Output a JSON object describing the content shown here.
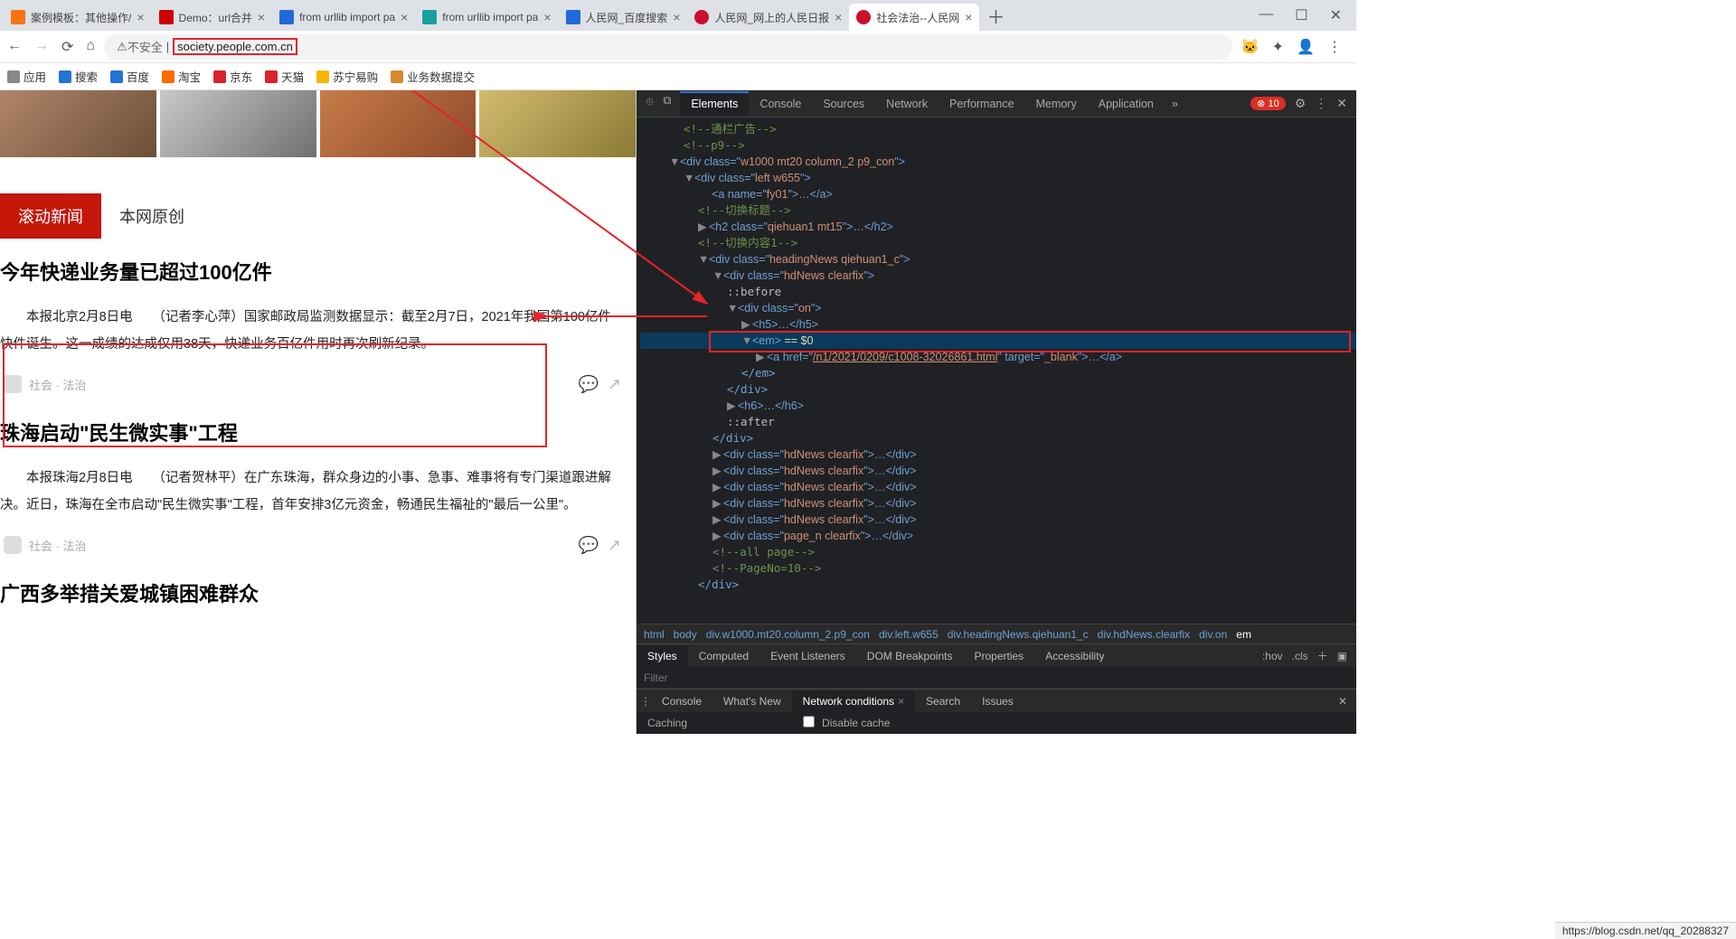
{
  "tabs": [
    {
      "title": "案例模板：其他操作/",
      "favicon": "orange"
    },
    {
      "title": "Demo：url合并",
      "favicon": "red"
    },
    {
      "title": "from urllib import pa",
      "favicon": "blue"
    },
    {
      "title": "from urllib import pa",
      "favicon": "teal"
    },
    {
      "title": "人民网_百度搜索",
      "favicon": "blue"
    },
    {
      "title": "人民网_网上的人民日报",
      "favicon": "redcircle"
    },
    {
      "title": "社会法治--人民网",
      "favicon": "redcircle",
      "active": true
    }
  ],
  "url": {
    "insecure": "不安全",
    "highlighted": "society.people.com.cn"
  },
  "bookmarks": [
    {
      "label": "应用",
      "icon": "#555"
    },
    {
      "label": "搜索",
      "icon": "#2473d5"
    },
    {
      "label": "百度",
      "icon": "#2473d5"
    },
    {
      "label": "淘宝",
      "icon": "#ff6a00"
    },
    {
      "label": "京东",
      "icon": "#d9232e"
    },
    {
      "label": "天猫",
      "icon": "#d9232e"
    },
    {
      "label": "苏宁易购",
      "icon": "#f7b500"
    },
    {
      "label": "业务数据提交",
      "icon": "#d98a2e"
    }
  ],
  "page": {
    "tab_active": "滚动新闻",
    "tab_other": "本网原创",
    "article1_title": "今年快递业务量已超过100亿件",
    "article1_body": "　　本报北京2月8日电　　（记者李心萍）国家邮政局监测数据显示：截至2月7日，2021年我国第100亿件快件诞生。这一成绩的达成仅用38天，快递业务百亿件用时再次刷新纪录。",
    "article2_title": "珠海启动\"民生微实事\"工程",
    "article2_body": "　　本报珠海2月8日电　　（记者贺林平）在广东珠海，群众身边的小事、急事、难事将有专门渠道跟进解决。近日，珠海在全市启动\"民生微实事\"工程，首年安排3亿元资金，畅通民生福祉的\"最后一公里\"。",
    "article3_title": "广西多举措关爱城镇困难群众",
    "tag": "社会 · 法治"
  },
  "devtools": {
    "tabs": [
      "Elements",
      "Console",
      "Sources",
      "Network",
      "Performance",
      "Memory",
      "Application"
    ],
    "errors": "10",
    "dom": {
      "c1": "<!--通栏广告-->",
      "c2": "<!--p9-->",
      "d1a": "<div class=\"",
      "d1v": "w1000 mt20 column_2 p9_con",
      "d1z": "\">",
      "d2a": "<div class=\"",
      "d2v": "left w655",
      "d2z": "\">",
      "a1": "<a name=\"",
      "a1v": "fy01",
      "a1z": "\">…</a>",
      "c3": "<!--切换标题-->",
      "h2a": "<h2 class=\"",
      "h2v": "qiehuan1 mt15",
      "h2z": "\">…</h2>",
      "c4": "<!--切换内容1-->",
      "d3a": "<div class=\"",
      "d3v": "headingNews qiehuan1_c",
      "d3z": "\">",
      "d4a": "<div class=\"",
      "d4v": "hdNews clearfix",
      "d4z": "\">",
      "before": "::before",
      "d5a": "<div class=\"",
      "d5v": "on",
      "d5z": "\">",
      "h5": "<h5>…</h5>",
      "em": "<em>",
      "emeq": " == $0",
      "link_a": "<a href=\"",
      "link_href": "/n1/2021/0209/c1008-32026861.html",
      "link_t": "\" target=\"",
      "link_tv": "_blank",
      "link_z": "\">…</a>",
      "close_em": "</em>",
      "close_div": "</div>",
      "h6": "<h6>…</h6>",
      "after": "::after",
      "d6a": "<div class=\"",
      "d6v": "hdNews clearfix",
      "d6z": "\">…</div>",
      "d7a": "<div class=\"",
      "d7v": "page_n clearfix",
      "d7z": "\">…</div>",
      "c5": "<!--all page-->",
      "c6": "<!--PageNo=10-->"
    },
    "crumbs": [
      "html",
      "body",
      "div.w1000.mt20.column_2.p9_con",
      "div.left.w655",
      "div.headingNews.qiehuan1_c",
      "div.hdNews.clearfix",
      "div.on",
      "em"
    ],
    "styles_tabs": [
      "Styles",
      "Computed",
      "Event Listeners",
      "DOM Breakpoints",
      "Properties",
      "Accessibility"
    ],
    "hov": ":hov",
    "cls": ".cls",
    "filter": "Filter",
    "bottom_tabs": [
      "Console",
      "What's New",
      "Network conditions",
      "Search",
      "Issues"
    ],
    "cache": "Caching",
    "disable_cache": "Disable cache"
  },
  "status_url": "https://blog.csdn.net/qq_20288327"
}
